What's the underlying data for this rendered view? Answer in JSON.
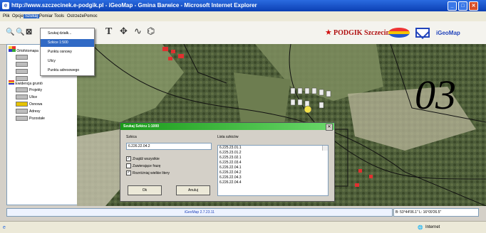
{
  "window": {
    "title": "http://www.szczecinek.e-podgik.pl - iGeoMap - Gmina Barwice - Microsoft Internet Explorer",
    "title_color": "#0b3fb3"
  },
  "menu": [
    "Plik",
    "Opcje",
    "Szukaj",
    "Pomiar",
    "Tools",
    "Ostrzeże",
    "Pomoc"
  ],
  "dropdown": {
    "items": [
      "Szukaj działk...",
      "Szkice 1:500",
      "Punktu osnowy",
      "Ulicy",
      "Punktu adresowego"
    ],
    "highlighted_index": 1
  },
  "toolbar": {
    "brand": "PODGIK Szczecinek",
    "brand_color": "#b01010",
    "app_logo": "iGeoMap",
    "icons": [
      "zoom-in-icon",
      "zoom-out-icon",
      "select-icon",
      "text-icon",
      "pan-icon",
      "measure-line-icon",
      "measure-area-icon",
      "mail-icon"
    ]
  },
  "layers": [
    {
      "label": "Ortofotomapa",
      "indent": 0
    },
    {
      "label": "",
      "indent": 1
    },
    {
      "label": "",
      "indent": 1
    },
    {
      "label": "",
      "indent": 1
    },
    {
      "label": "",
      "indent": 1
    },
    {
      "label": "Ewidencja gruntó",
      "indent": 0
    },
    {
      "label": "Projekty",
      "indent": 1
    },
    {
      "label": "Ulice",
      "indent": 1
    },
    {
      "label": "Osnowa",
      "indent": 1
    },
    {
      "label": "Adresy",
      "indent": 1
    },
    {
      "label": "Pozostałe",
      "indent": 1
    }
  ],
  "map": {
    "sheet_number": "03"
  },
  "dialog": {
    "title": "Szukaj Szkicu 1:1000",
    "field_label": "Szkica",
    "field_value": "6.226.22.04.2",
    "list_label": "Lista szkiców",
    "list_items": [
      "6.225.23.01.1",
      "6.225.23.01.2",
      "6.225.23.02.1",
      "6.225.22.03.4",
      "6.226.22.04.1",
      "6.226.22.04.2",
      "6.226.22.04.3",
      "6.226.22.04.4"
    ],
    "checkboxes": [
      {
        "label": "Znajdź wszystkie",
        "checked": true
      },
      {
        "label": "Zawierające frazę",
        "checked": false
      },
      {
        "label": "Rozróżniaj wielkie litery",
        "checked": true
      }
    ],
    "ok_label": "Ok",
    "cancel_label": "Anuluj"
  },
  "status": {
    "version": "iGeoMap 2.7.23.11",
    "coords": "B: 53°44'06.1\" L: 16°09'26.5\"",
    "zone": "Internet"
  }
}
